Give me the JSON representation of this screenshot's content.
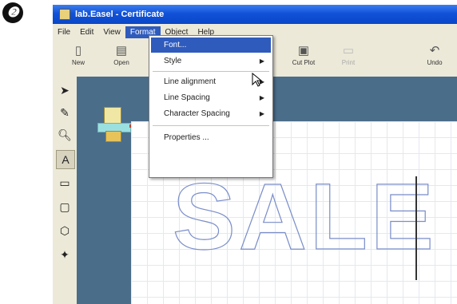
{
  "step_number": "❷",
  "window": {
    "title": "lab.Easel - Certificate"
  },
  "menubar": {
    "items": [
      {
        "label": "File"
      },
      {
        "label": "Edit"
      },
      {
        "label": "View"
      },
      {
        "label": "Format",
        "active": true
      },
      {
        "label": "Object"
      },
      {
        "label": "Help"
      }
    ]
  },
  "toolbar": {
    "buttons": [
      {
        "label": "New",
        "icon": "new-document-icon",
        "disabled": false
      },
      {
        "label": "Open",
        "icon": "open-icon",
        "disabled": false
      },
      {
        "label": "Cut Plot",
        "icon": "cut-plot-icon",
        "disabled": false
      },
      {
        "label": "Print",
        "icon": "print-icon",
        "disabled": true
      },
      {
        "label": "Undo",
        "icon": "undo-icon",
        "disabled": false
      }
    ]
  },
  "format_menu": {
    "items": [
      {
        "label": "Font...",
        "has_submenu": false,
        "highlight": true
      },
      {
        "label": "Style",
        "has_submenu": true
      },
      {
        "label": "Line alignment",
        "has_submenu": true
      },
      {
        "label": "Line Spacing",
        "has_submenu": true
      },
      {
        "label": "Character Spacing",
        "has_submenu": true
      },
      {
        "label": "Properties ...",
        "has_submenu": false
      }
    ]
  },
  "canvas": {
    "text": "SALE"
  },
  "colors": {
    "titlebar": "#1152d8",
    "highlight": "#2f5bbd",
    "panel": "#4a6d8a",
    "outline": "#7a8ec9"
  }
}
